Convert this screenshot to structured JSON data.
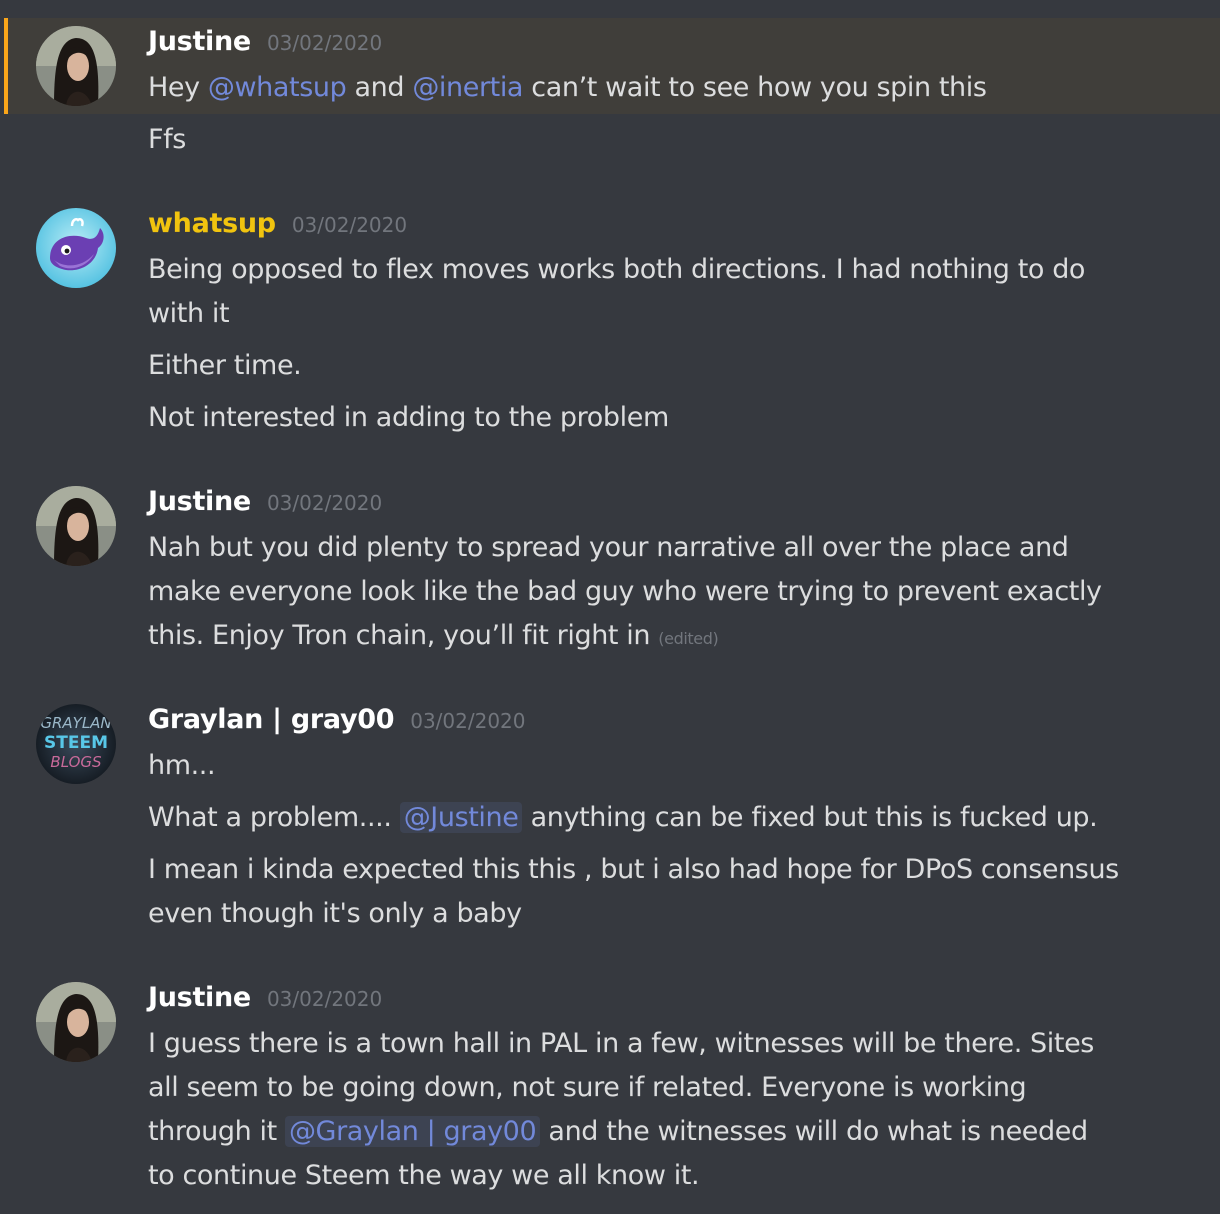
{
  "messages": [
    {
      "username": "Justine",
      "timestamp": "03/02/2020",
      "line1": {
        "pre": "Hey ",
        "m1": "@whatsup",
        "mid": " and ",
        "m2": "@inertia",
        "post": " can’t wait to see how you spin this"
      },
      "line2": "Ffs"
    },
    {
      "username": "whatsup",
      "timestamp": "03/02/2020",
      "line1": "Being opposed to flex moves works both directions.  I had nothing to do",
      "line2": "with it",
      "line3": "Either time.",
      "line4": "Not interested in adding to the problem"
    },
    {
      "username": "Justine",
      "timestamp": "03/02/2020",
      "line1": "Nah but you did plenty to spread your narrative all over the place and",
      "line2": "make everyone look like the bad guy who were trying to prevent exactly",
      "line3": "this. Enjoy Tron chain, you’ll fit right in",
      "edited": "(edited)"
    },
    {
      "username": "Graylan | gray00",
      "timestamp": "03/02/2020",
      "avatar_text": [
        "GRAYLAN",
        "STEEM",
        "BLOGS"
      ],
      "line1": "hm...",
      "line2": {
        "pre": "What a problem.... ",
        "m": "@Justine",
        "post": " anything can be fixed but this is fucked up."
      },
      "line3": "I mean i kinda expected this this , but i also had hope for DPoS consensus",
      "line4": "even though it's only a baby"
    },
    {
      "username": "Justine",
      "timestamp": "03/02/2020",
      "line1": "I guess there is a town hall in PAL in a few, witnesses will be there. Sites",
      "line2": "all seem to be going down, not sure if related. Everyone is working",
      "line3": {
        "pre": "through it ",
        "m": "@Graylan | gray00",
        "post": " and the witnesses will do what is needed"
      },
      "line4": "to continue Steem the way we all know it."
    }
  ],
  "colors": {
    "background": "#36393f",
    "mention": "#7289da",
    "whatsup_name": "#f1c40f",
    "highlight_bar": "#faa61a"
  }
}
